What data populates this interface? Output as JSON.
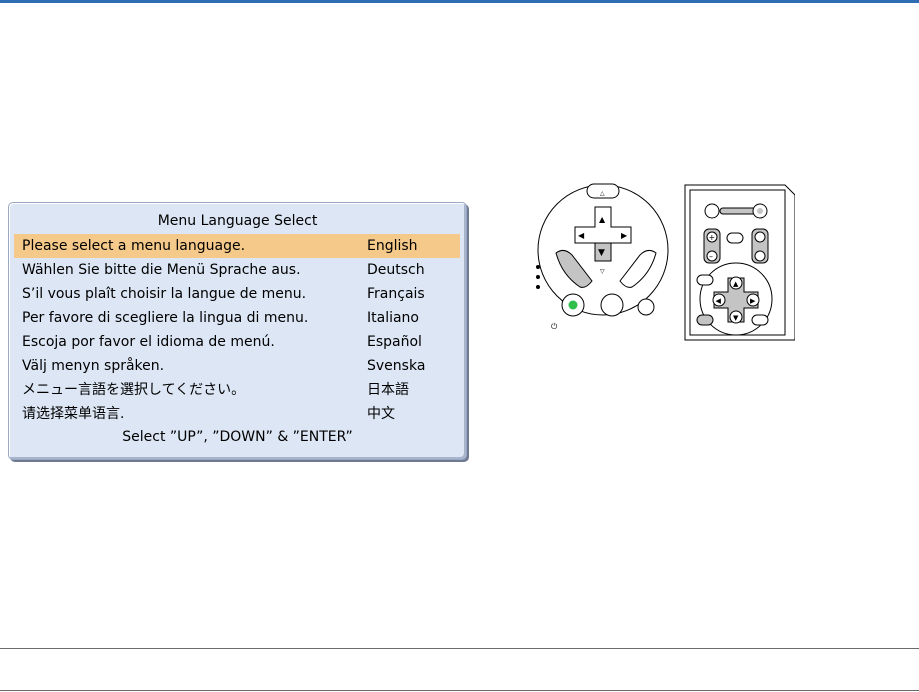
{
  "menu": {
    "title": "Menu Language Select",
    "rows": [
      {
        "message": "Please select a menu language.",
        "language": "English",
        "selected": true
      },
      {
        "message": "Wählen Sie bitte die Menü Sprache aus.",
        "language": "Deutsch",
        "selected": false
      },
      {
        "message": "S’il vous plaît choisir la langue de menu.",
        "language": "Français",
        "selected": false
      },
      {
        "message": "Per favore di scegliere la lingua di menu.",
        "language": "Italiano",
        "selected": false
      },
      {
        "message": "Escoja por favor el idioma de menú.",
        "language": "Español",
        "selected": false
      },
      {
        "message": "Välj menyn språken.",
        "language": "Svenska",
        "selected": false
      },
      {
        "message": "メニュー言語を選択してください。",
        "language": "日本語",
        "selected": false
      },
      {
        "message": "请选择菜单语言.",
        "language": "中文",
        "selected": false
      }
    ],
    "footer": "Select ”UP”, ”DOWN” & ”ENTER”"
  },
  "colors": {
    "accent_rule": "#2e6db4",
    "panel_bg": "#dde6f5",
    "selection_bg": "#f5c98a",
    "power_led": "#2fbf4a",
    "highlight_gray": "#c4c4c4"
  },
  "illustration": {
    "device_panel_icon": "projector-control-panel",
    "remote_icon": "remote-control"
  }
}
